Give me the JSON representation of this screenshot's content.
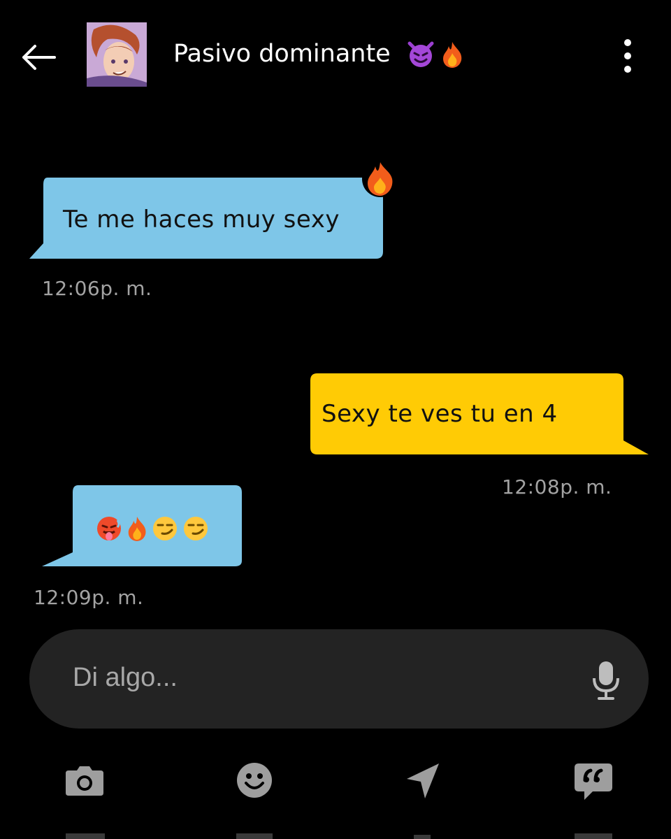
{
  "header": {
    "title": "Pasivo dominante",
    "title_emojis": [
      "smiling-imp-emoji",
      "fire-emoji"
    ],
    "back_icon": "back-arrow-icon",
    "menu_icon": "more-vertical-icon"
  },
  "messages": [
    {
      "direction": "incoming",
      "text": "Te me haces muy sexy",
      "time": "12:06p. m.",
      "reaction": "fire-emoji"
    },
    {
      "direction": "outgoing",
      "text": "Sexy te ves tu en 4",
      "time": "12:08p. m."
    },
    {
      "direction": "incoming",
      "emojis": [
        "hot-face-emoji",
        "fire-emoji",
        "smirking-face-emoji",
        "smirking-face-emoji"
      ],
      "time": "12:09p. m."
    }
  ],
  "composer": {
    "placeholder": "Di algo..."
  },
  "toolbar": {
    "icons": [
      "camera-icon",
      "emoji-icon",
      "location-icon",
      "quick-reply-icon"
    ]
  },
  "colors": {
    "background": "#000000",
    "incoming_bubble": "#7ec6e8",
    "outgoing_bubble": "#ffcb05",
    "timestamp": "#a3a3a3",
    "input_background": "#232323",
    "icon": "#9e9e9e"
  }
}
